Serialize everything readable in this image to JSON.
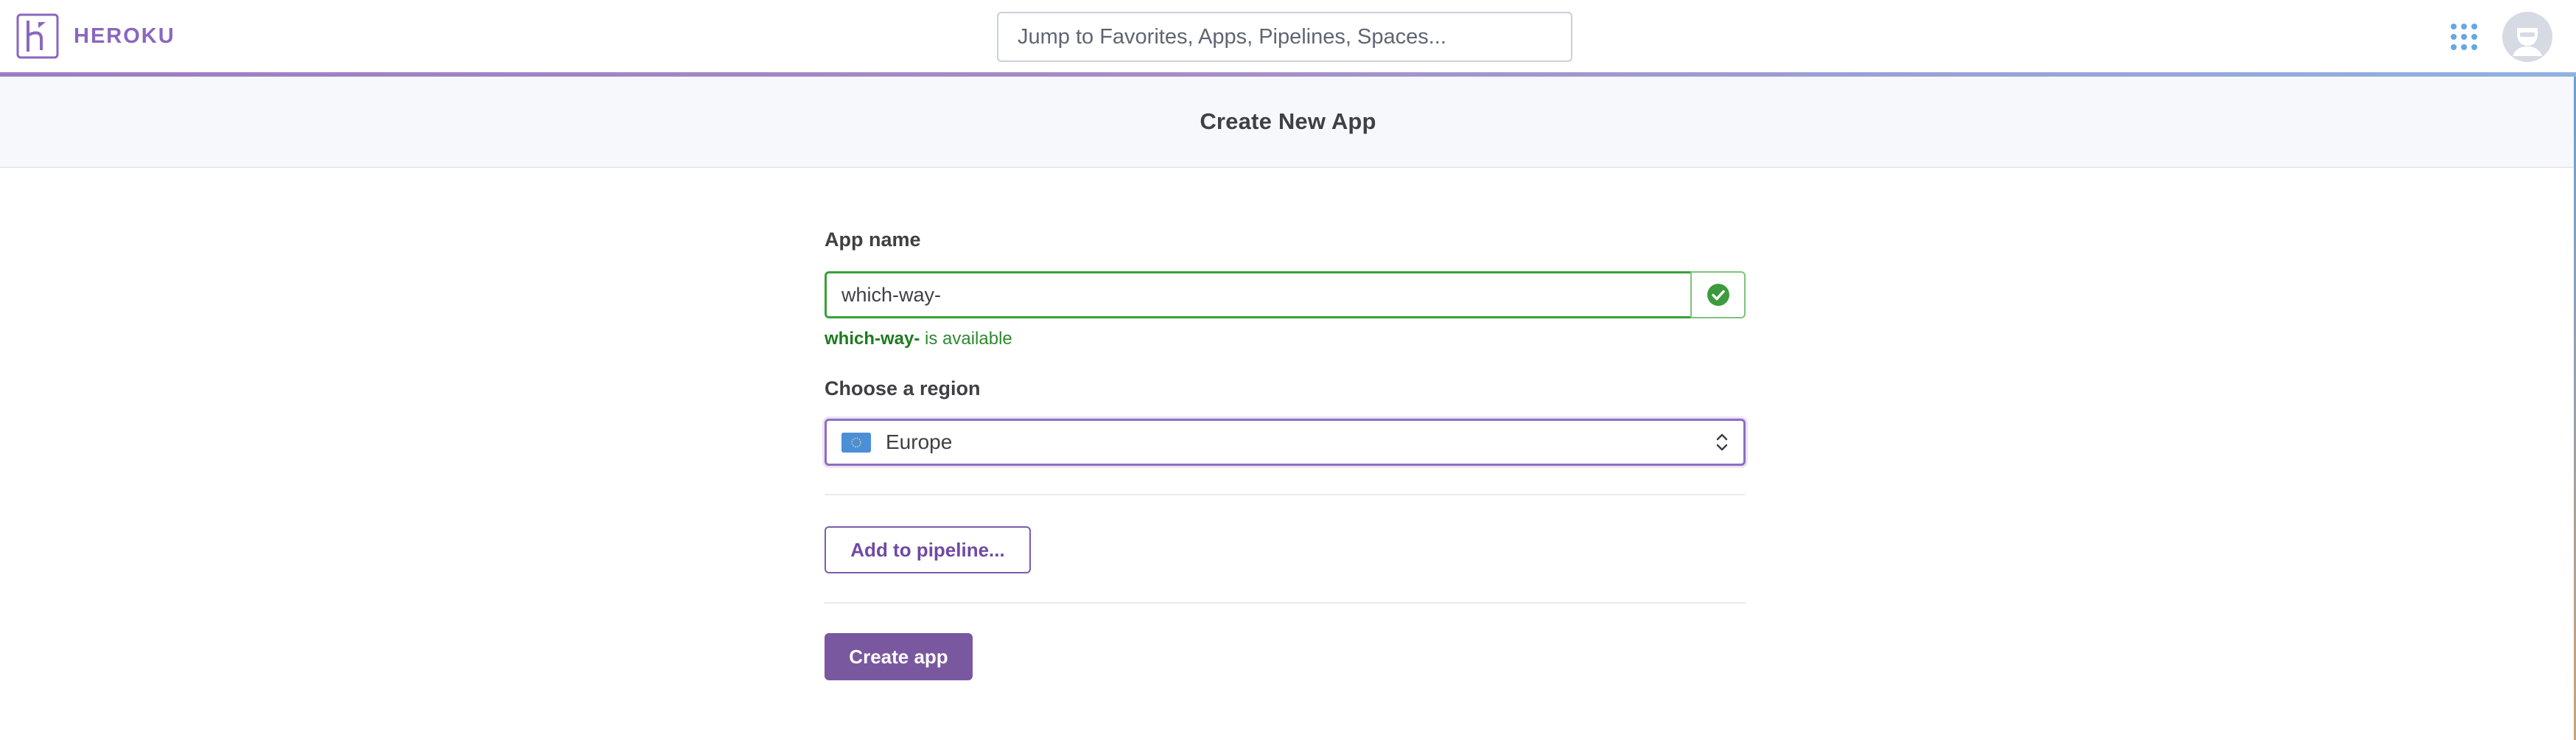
{
  "header": {
    "brand_name": "HEROKU",
    "search": {
      "placeholder": "Jump to Favorites, Apps, Pipelines, Spaces...",
      "value": ""
    },
    "icons": {
      "logo": "heroku-logo-icon",
      "apps_menu": "grid-apps-icon",
      "avatar": "user-avatar-icon"
    }
  },
  "page": {
    "title": "Create New App"
  },
  "form": {
    "app_name": {
      "label": "App name",
      "value": "which-way-",
      "status_icon": "check-circle-icon",
      "availability": {
        "name": "which-way-",
        "message": " is available"
      }
    },
    "region": {
      "label": "Choose a region",
      "selected": "Europe",
      "flag_icon": "eu-flag-icon",
      "chevron_icon": "chevron-updown-icon"
    },
    "pipeline_button_label": "Add to pipeline...",
    "create_button_label": "Create app"
  },
  "colors": {
    "brand_purple": "#79589f",
    "success_green": "#38a138",
    "focus_purple": "#8f6dc0",
    "header_bg": "#f6f8fb"
  }
}
